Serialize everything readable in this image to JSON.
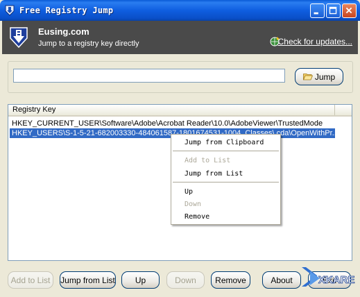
{
  "window": {
    "title": "Free Registry Jump",
    "controls": [
      "minimize-icon",
      "maximize-icon",
      "close-icon"
    ]
  },
  "header": {
    "brand": "Eusing.com",
    "tagline": "Jump to a registry key directly",
    "update_link": "Check for updates..."
  },
  "input": {
    "value": "",
    "placeholder": "",
    "jump_button": "Jump"
  },
  "list": {
    "column_header": "Registry Key",
    "rows": [
      "HKEY_CURRENT_USER\\Software\\Adobe\\Acrobat Reader\\10.0\\AdobeViewer\\TrustedMode",
      "HKEY_USERS\\S-1-5-21-682003330-484061587-1801674531-1004_Classes\\.cda\\OpenWithPr..."
    ],
    "selected_index": 1
  },
  "context_menu": {
    "items": [
      {
        "label": "Jump from Clipboard",
        "enabled": true
      },
      {
        "label": "Add to List",
        "enabled": false
      },
      {
        "label": "Jump from List",
        "enabled": true
      },
      {
        "label": "Up",
        "enabled": true
      },
      {
        "label": "Down",
        "enabled": false
      },
      {
        "label": "Remove",
        "enabled": true
      }
    ]
  },
  "footer": {
    "add_to_list": "Add to List",
    "jump_from_list": "Jump from List",
    "up": "Up",
    "down": "Down",
    "remove": "Remove",
    "about": "About",
    "exit": "Exit"
  },
  "watermark": {
    "text": "XKARE"
  },
  "colors": {
    "titlebar": "#0a5bd6",
    "header_band": "#4a4a4a",
    "selection": "#316ac5",
    "window_bg": "#ece9d8"
  }
}
